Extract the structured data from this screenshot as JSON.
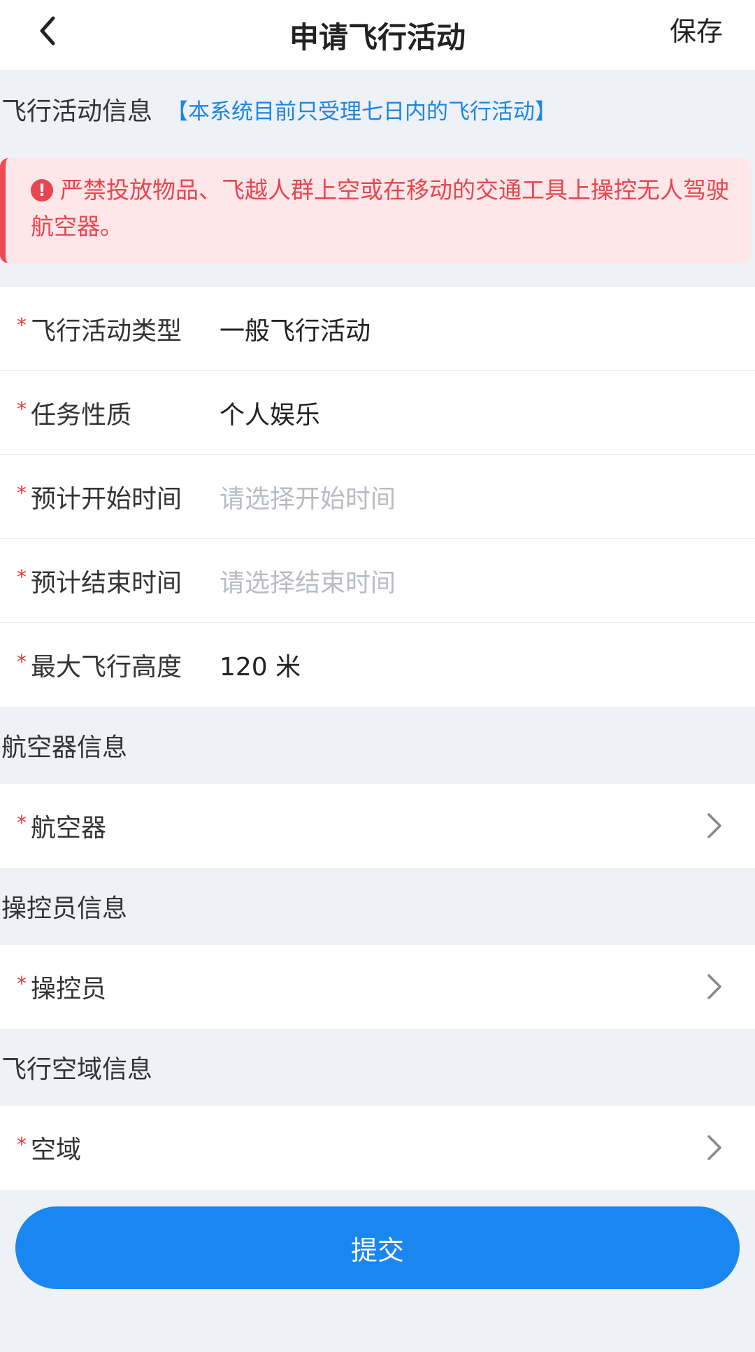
{
  "header": {
    "title": "申请飞行活动",
    "save_label": "保存"
  },
  "info_section": {
    "title": "飞行活动信息",
    "note": "【本系统目前只受理七日内的飞行活动】",
    "alert_text": "严禁投放物品、飞越人群上空或在移动的交通工具上操控无人驾驶航空器。"
  },
  "fields": [
    {
      "label": "飞行活动类型",
      "value": "一般飞行活动"
    },
    {
      "label": "任务性质",
      "value": "个人娱乐"
    },
    {
      "label": "预计开始时间",
      "placeholder": "请选择开始时间"
    },
    {
      "label": "预计结束时间",
      "placeholder": "请选择结束时间"
    },
    {
      "label": "最大飞行高度",
      "value": "120 米"
    }
  ],
  "aircraft_section": {
    "title": "航空器信息",
    "label": "航空器"
  },
  "operator_section": {
    "title": "操控员信息",
    "label": "操控员"
  },
  "airspace_section": {
    "title": "飞行空域信息",
    "label": "空域"
  },
  "required_mark": "*",
  "submit_label": "提交",
  "colors": {
    "accent": "#1a86f0",
    "alert": "#e84550",
    "required": "#e03a3a"
  }
}
